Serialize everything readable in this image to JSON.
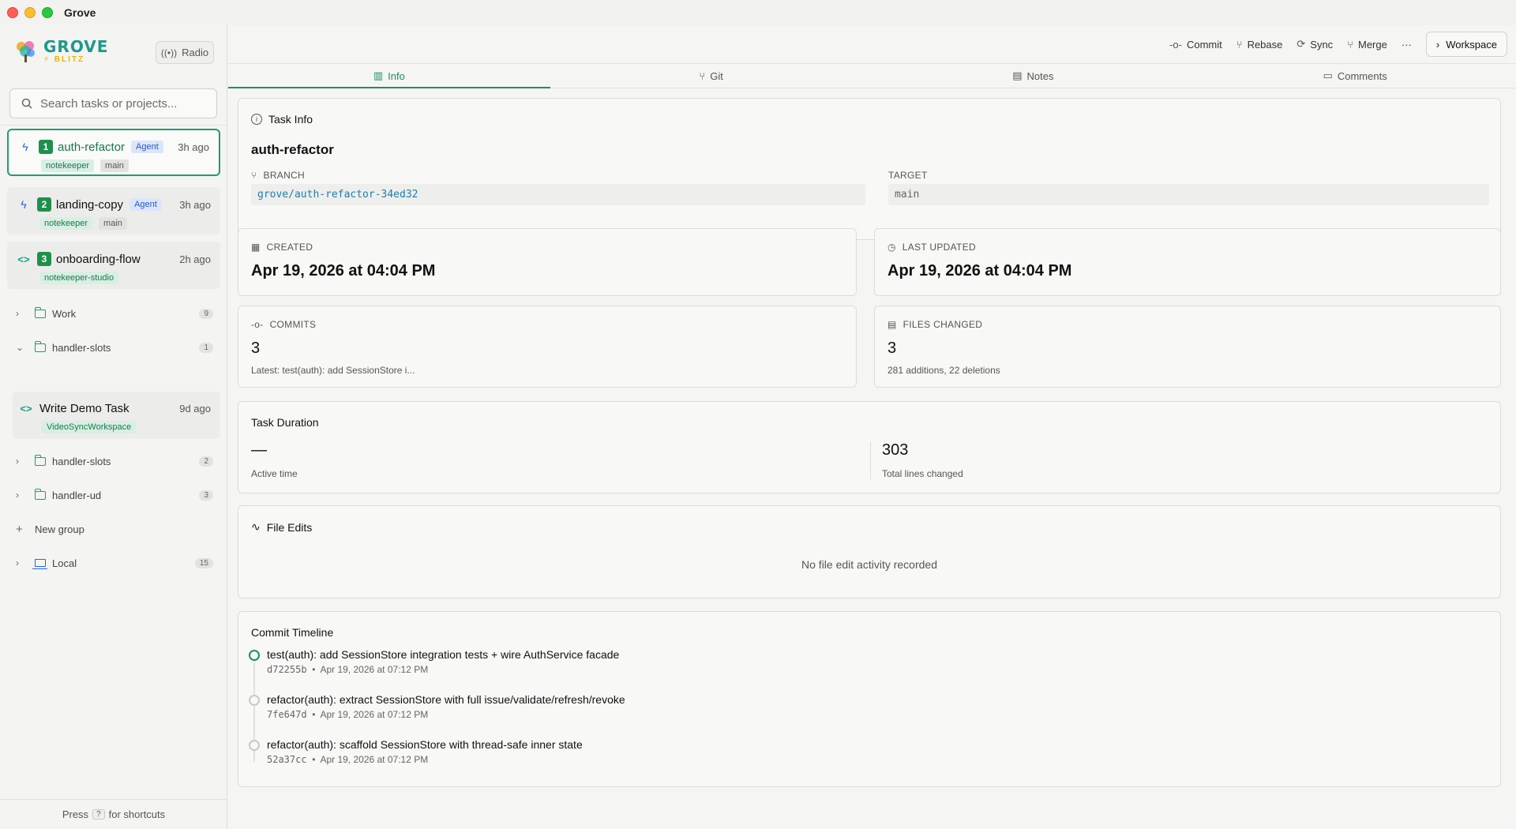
{
  "window": {
    "title": "Grove"
  },
  "sidebar": {
    "logo": {
      "line1": "GROVE",
      "line2": "⚡ BLITZ"
    },
    "radio_label": "Radio",
    "search_placeholder": "Search tasks or projects...",
    "tasks": [
      {
        "num": "1",
        "name": "auth-refactor",
        "badge": "Agent",
        "ago": "3h ago",
        "tags": [
          "notekeeper",
          "main"
        ]
      },
      {
        "num": "2",
        "name": "landing-copy",
        "badge": "Agent",
        "ago": "3h ago",
        "tags": [
          "notekeeper",
          "main"
        ]
      },
      {
        "num": "3",
        "name": "onboarding-flow",
        "ago": "2h ago",
        "tags": [
          "notekeeper-studio"
        ]
      }
    ],
    "groups": [
      {
        "label": "Work",
        "count": "9"
      },
      {
        "label": "handler-slots",
        "count": "1"
      },
      {
        "label": "handler-slots",
        "count": "2"
      },
      {
        "label": "handler-ud",
        "count": "3"
      }
    ],
    "group_task": {
      "name": "Write Demo Task",
      "ago": "9d ago",
      "tag": "VideoSyncWorkspace"
    },
    "new_group": "New group",
    "local": {
      "label": "Local",
      "count": "15"
    },
    "footer": {
      "press": "Press",
      "key": "?",
      "rest": "for shortcuts"
    }
  },
  "toolbar": {
    "commit": "Commit",
    "rebase": "Rebase",
    "sync": "Sync",
    "merge": "Merge",
    "more": "···",
    "workspace": "Workspace"
  },
  "tabs": [
    "Info",
    "Git",
    "Notes",
    "Comments"
  ],
  "task_info": {
    "title": "Task Info",
    "name": "auth-refactor",
    "branch_label": "BRANCH",
    "branch": "grove/auth-refactor-34ed32",
    "target_label": "TARGET",
    "target": "main"
  },
  "created": {
    "label": "CREATED",
    "value": "Apr 19, 2026 at 04:04 PM"
  },
  "updated": {
    "label": "LAST UPDATED",
    "value": "Apr 19, 2026 at 04:04 PM"
  },
  "commits": {
    "label": "COMMITS",
    "value": "3",
    "sub": "Latest: test(auth): add SessionStore i..."
  },
  "files": {
    "label": "FILES CHANGED",
    "value": "3",
    "sub": "281 additions, 22 deletions"
  },
  "duration": {
    "title": "Task Duration",
    "active_value": "—",
    "active_label": "Active time",
    "lines_value": "303",
    "lines_label": "Total lines changed"
  },
  "file_edits": {
    "title": "File Edits",
    "empty": "No file edit activity recorded"
  },
  "timeline": {
    "title": "Commit Timeline",
    "items": [
      {
        "msg": "test(auth): add SessionStore integration tests + wire AuthService facade",
        "hash": "d72255b",
        "date": "Apr 19, 2026 at 07:12 PM"
      },
      {
        "msg": "refactor(auth): extract SessionStore with full issue/validate/refresh/revoke",
        "hash": "7fe647d",
        "date": "Apr 19, 2026 at 07:12 PM"
      },
      {
        "msg": "refactor(auth): scaffold SessionStore with thread-safe inner state",
        "hash": "52a37cc",
        "date": "Apr 19, 2026 at 07:12 PM"
      }
    ]
  }
}
